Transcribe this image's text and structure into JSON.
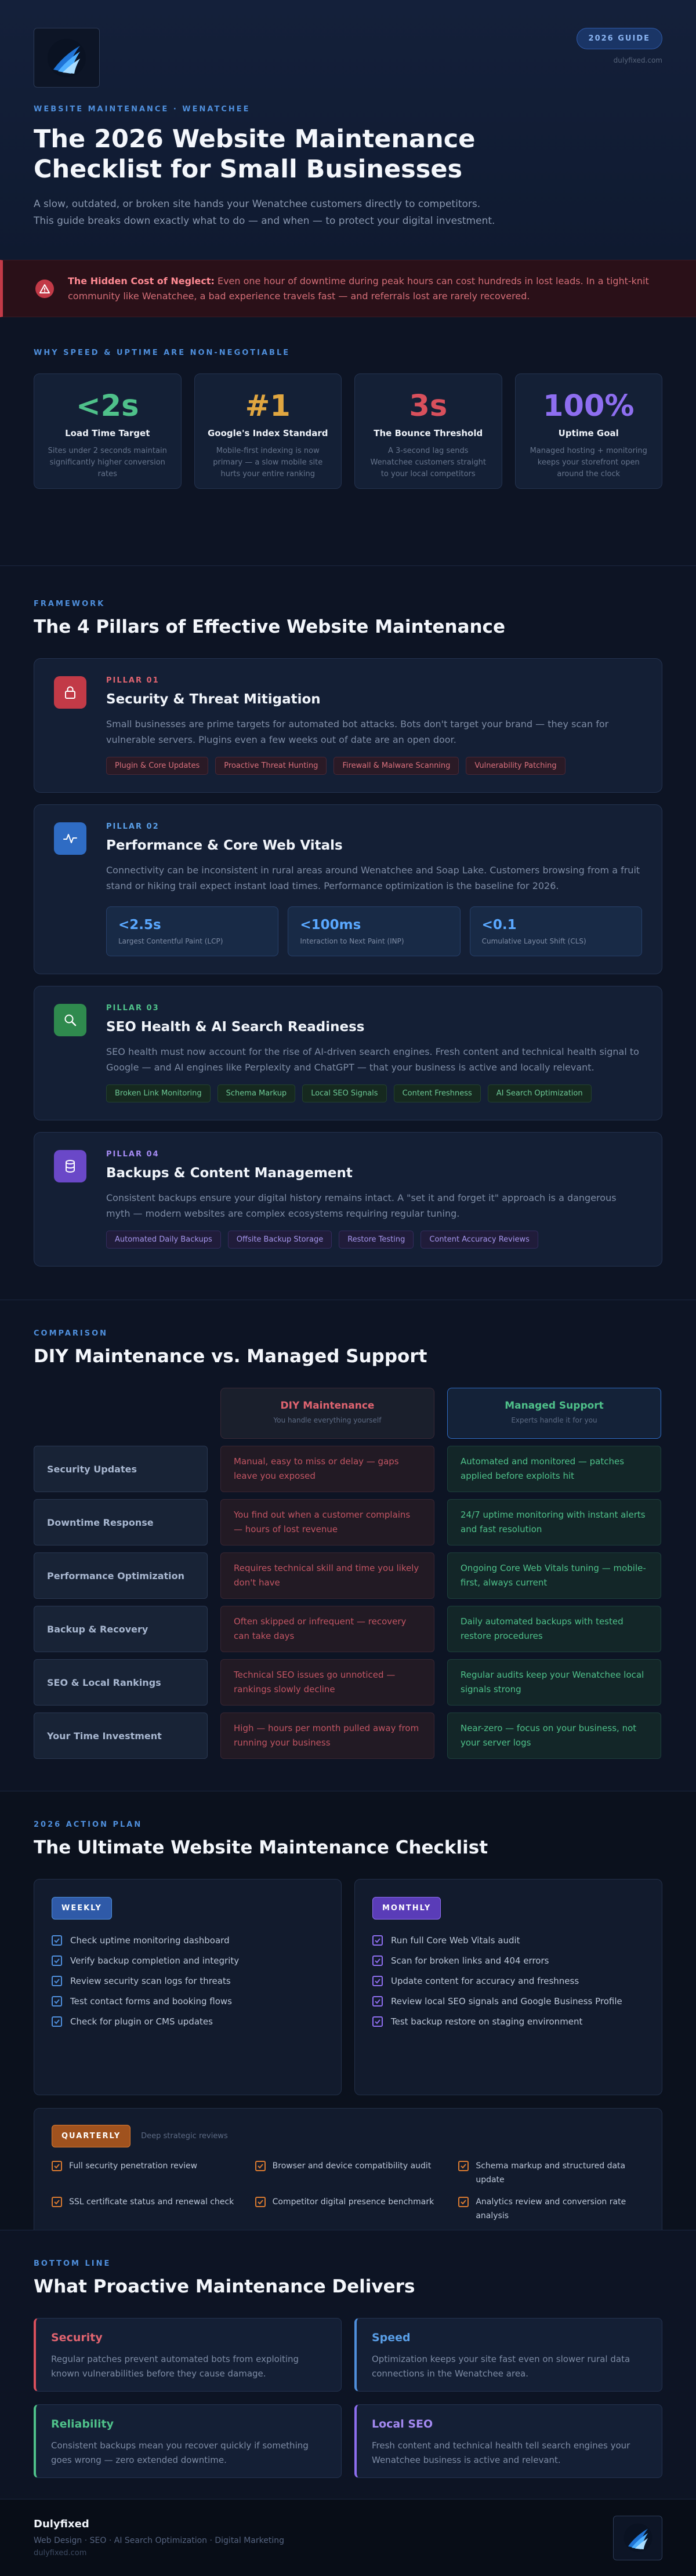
{
  "hero": {
    "badge": "2026 GUIDE",
    "site": "dulyfixed.com",
    "kicker": "WEBSITE MAINTENANCE · WENATCHEE",
    "title": "The 2026 Website Maintenance Checklist for Small Businesses",
    "subtitle": "A slow, outdated, or broken site hands your Wenatchee customers directly to competitors. This guide breaks down exactly what to do — and when — to protect your digital investment."
  },
  "alert": {
    "lead": "The Hidden Cost of Neglect:",
    "text": " Even one hour of downtime during peak hours can cost hundreds in lost leads. In a tight-knit community like Wenatchee, a bad experience travels fast — and referrals lost are rarely recovered.",
    "icon": "warning-icon"
  },
  "stats": {
    "label": "WHY SPEED & UPTIME ARE NON-NEGOTIABLE",
    "items": [
      {
        "value": "<2s",
        "title": "Load Time Target",
        "desc": "Sites under 2 seconds maintain significantly higher conversion rates",
        "color": "#4fc18a"
      },
      {
        "value": "#1",
        "title": "Google's Index Standard",
        "desc": "Mobile-first indexing is now primary — a slow mobile site hurts your entire ranking",
        "color": "#e0a640"
      },
      {
        "value": "3s",
        "title": "The Bounce Threshold",
        "desc": "A 3-second lag sends Wenatchee customers straight to your local competitors",
        "color": "#d9505c"
      },
      {
        "value": "100%",
        "title": "Uptime Goal",
        "desc": "Managed hosting + monitoring keeps your storefront open around the clock",
        "color": "#8e6ef0"
      }
    ]
  },
  "pillars": {
    "label": "FRAMEWORK",
    "title": "The 4 Pillars of Effective Website Maintenance",
    "items": [
      {
        "label": "PILLAR 01",
        "title": "Security & Threat Mitigation",
        "desc": "Small businesses are prime targets for automated bot attacks. Bots don't target your brand — they scan for vulnerable servers. Plugins even a few weeks out of date are an open door.",
        "tags": [
          "Plugin & Core Updates",
          "Proactive Threat Hunting",
          "Firewall & Malware Scanning",
          "Vulnerability Patching"
        ],
        "icon": "lock-icon",
        "accent": "#d9505c"
      },
      {
        "label": "PILLAR 02",
        "title": "Performance & Core Web Vitals",
        "desc": "Connectivity can be inconsistent in rural areas around Wenatchee and Soap Lake. Customers browsing from a fruit stand or hiking trail expect instant load times. Performance optimization is the baseline for 2026.",
        "metrics": [
          {
            "value": "<2.5s",
            "label": "Largest Contentful Paint (LCP)"
          },
          {
            "value": "<100ms",
            "label": "Interaction to Next Paint (INP)"
          },
          {
            "value": "<0.1",
            "label": "Cumulative Layout Shift (CLS)"
          }
        ],
        "icon": "pulse-icon",
        "accent": "#4f8fdc"
      },
      {
        "label": "PILLAR 03",
        "title": "SEO Health & AI Search Readiness",
        "desc": "SEO health must now account for the rise of AI-driven search engines. Fresh content and technical health signal to Google — and AI engines like Perplexity and ChatGPT — that your business is active and locally relevant.",
        "tags": [
          "Broken Link Monitoring",
          "Schema Markup",
          "Local SEO Signals",
          "Content Freshness",
          "AI Search Optimization"
        ],
        "icon": "search-icon",
        "accent": "#4fc18a"
      },
      {
        "label": "PILLAR 04",
        "title": "Backups & Content Management",
        "desc": "Consistent backups ensure your digital history remains intact. A \"set it and forget it\" approach is a dangerous myth — modern websites are complex ecosystems requiring regular tuning.",
        "tags": [
          "Automated Daily Backups",
          "Offsite Backup Storage",
          "Restore Testing",
          "Content Accuracy Reviews"
        ],
        "icon": "database-icon",
        "accent": "#8e6ef0"
      }
    ]
  },
  "comparison": {
    "label": "COMPARISON",
    "title": "DIY Maintenance vs. Managed Support",
    "diy_head": "DIY Maintenance",
    "diy_sub": "You handle everything yourself",
    "man_head": "Managed Support",
    "man_sub": "Experts handle it for you",
    "rows": [
      {
        "label": "Security Updates",
        "diy": "Manual, easy to miss or delay — gaps leave you exposed",
        "managed": "Automated and monitored — patches applied before exploits hit"
      },
      {
        "label": "Downtime Response",
        "diy": "You find out when a customer complains — hours of lost revenue",
        "managed": "24/7 uptime monitoring with instant alerts and fast resolution"
      },
      {
        "label": "Performance Optimization",
        "diy": "Requires technical skill and time you likely don't have",
        "managed": "Ongoing Core Web Vitals tuning — mobile-first, always current"
      },
      {
        "label": "Backup & Recovery",
        "diy": "Often skipped or infrequent — recovery can take days",
        "managed": "Daily automated backups with tested restore procedures"
      },
      {
        "label": "SEO & Local Rankings",
        "diy": "Technical SEO issues go unnoticed — rankings slowly decline",
        "managed": "Regular audits keep your Wenatchee local signals strong"
      },
      {
        "label": "Your Time Investment",
        "diy": "High — hours per month pulled away from running your business",
        "managed": "Near-zero — focus on your business, not your server logs"
      }
    ]
  },
  "checklist": {
    "label": "2026 ACTION PLAN",
    "title": "The Ultimate Website Maintenance Checklist",
    "weekly": {
      "badge": "WEEKLY",
      "items": [
        "Check uptime monitoring dashboard",
        "Verify backup completion and integrity",
        "Review security scan logs for threats",
        "Test contact forms and booking flows",
        "Check for plugin or CMS updates"
      ]
    },
    "monthly": {
      "badge": "MONTHLY",
      "items": [
        "Run full Core Web Vitals audit",
        "Scan for broken links and 404 errors",
        "Update content for accuracy and freshness",
        "Review local SEO signals and Google Business Profile",
        "Test backup restore on staging environment"
      ]
    },
    "quarterly": {
      "badge": "QUARTERLY",
      "sub": "Deep strategic reviews",
      "items": [
        "Full security penetration review",
        "Browser and device compatibility audit",
        "Schema markup and structured data update",
        "SSL certificate status and renewal check",
        "Competitor digital presence benchmark",
        "Analytics review and conversion rate analysis"
      ]
    }
  },
  "bottom": {
    "label": "BOTTOM LINE",
    "title": "What Proactive Maintenance Delivers",
    "items": [
      {
        "title": "Security",
        "desc": "Regular patches prevent automated bots from exploiting known vulnerabilities before they cause damage.",
        "color": "#d9505c"
      },
      {
        "title": "Speed",
        "desc": "Optimization keeps your site fast even on slower rural data connections in the Wenatchee area.",
        "color": "#4f8fdc"
      },
      {
        "title": "Reliability",
        "desc": "Consistent backups mean you recover quickly if something goes wrong — zero extended downtime.",
        "color": "#4fc18a"
      },
      {
        "title": "Local SEO",
        "desc": "Fresh content and technical health tell search engines your Wenatchee business is active and relevant.",
        "color": "#8e6ef0"
      }
    ]
  },
  "footer": {
    "brand": "Dulyfixed",
    "services": "Web Design · SEO · AI Search Optimization · Digital Marketing",
    "url": "dulyfixed.com"
  }
}
